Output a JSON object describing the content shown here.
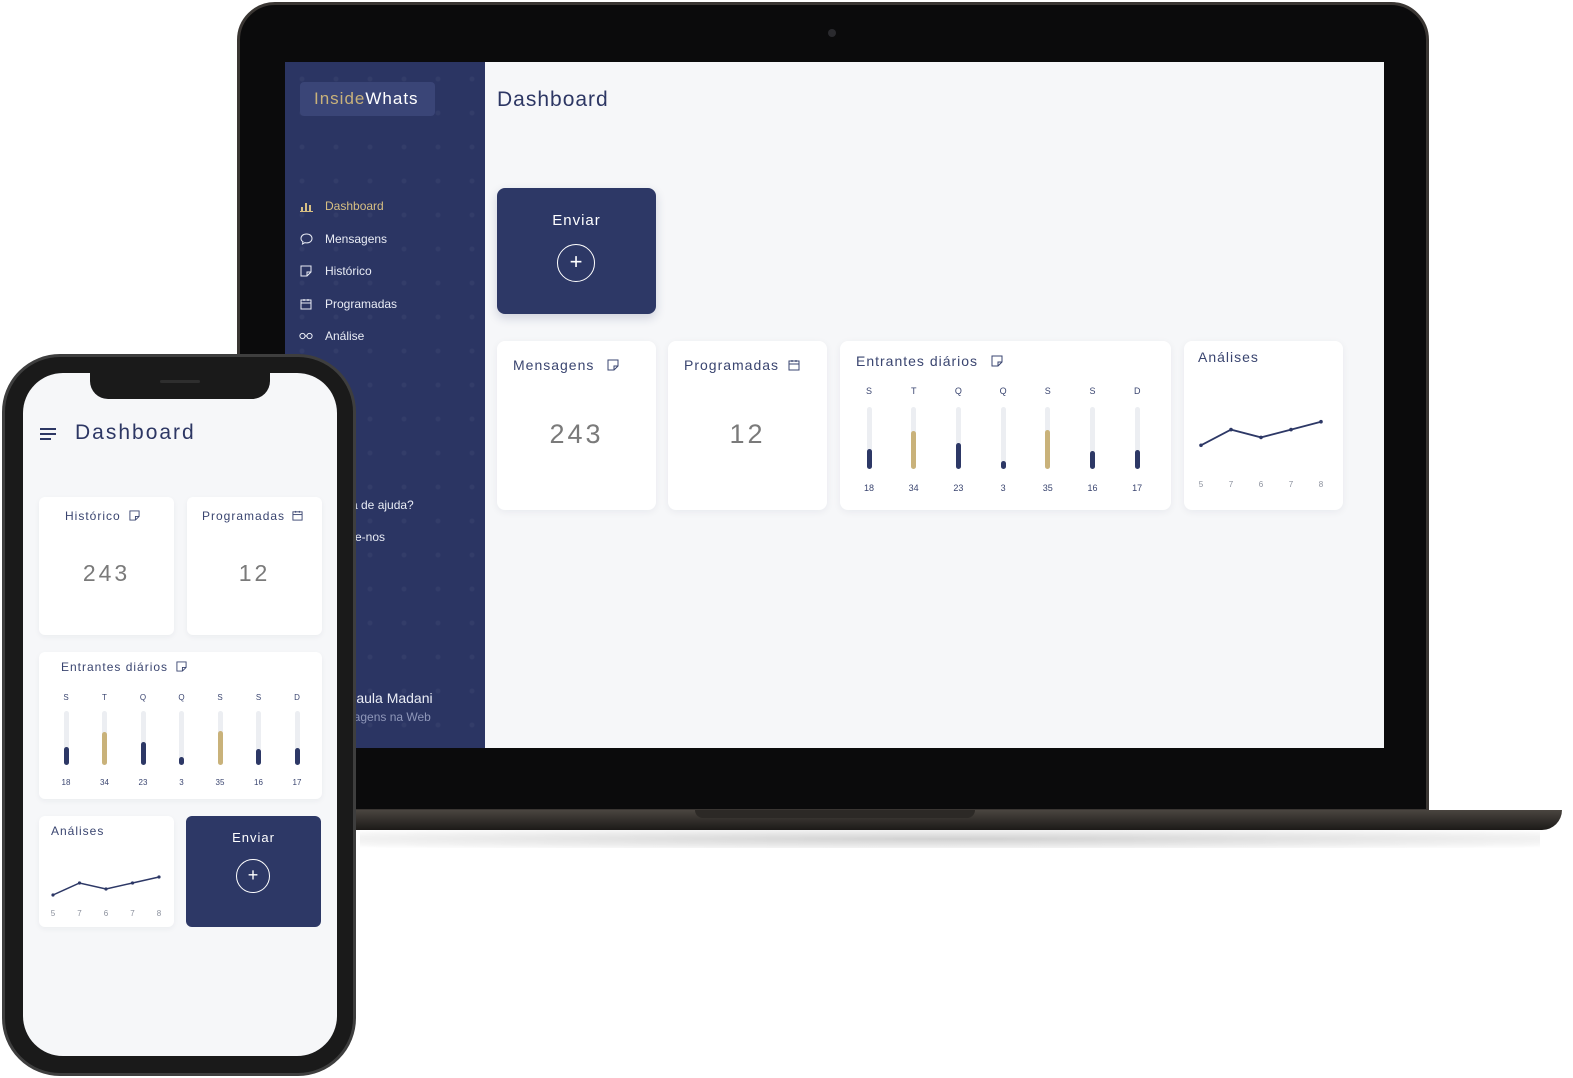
{
  "laptop": {
    "logo": {
      "part1": "Inside",
      "part2": "Whats"
    },
    "nav": [
      {
        "label": "Dashboard",
        "icon": "bar-chart-icon",
        "active": true
      },
      {
        "label": "Mensagens",
        "icon": "message-icon",
        "active": false
      },
      {
        "label": "Histórico",
        "icon": "note-icon",
        "active": false
      },
      {
        "label": "Programadas",
        "icon": "calendar-icon",
        "active": false
      },
      {
        "label": "Análise",
        "icon": "glasses-icon",
        "active": false
      }
    ],
    "help_text": "sa de ajuda?",
    "contact_text": "ate-nos",
    "user": {
      "name": "Paula Madani",
      "subtitle": "nagens na Web"
    },
    "page_title": "Dashboard",
    "send_card": {
      "label": "Enviar",
      "icon": "plus-icon"
    },
    "cards": {
      "mensagens": {
        "title": "Mensagens",
        "value": "243",
        "icon": "note-icon"
      },
      "programadas": {
        "title": "Programadas",
        "value": "12",
        "icon": "calendar-icon"
      },
      "entrantes": {
        "title": "Entrantes diários",
        "icon": "note-icon"
      },
      "analises": {
        "title": "Análises"
      }
    }
  },
  "phone": {
    "page_title": "Dashboard",
    "cards": {
      "historico": {
        "title": "Histórico",
        "value": "243",
        "icon": "note-icon"
      },
      "programadas": {
        "title": "Programadas",
        "value": "12",
        "icon": "calendar-icon"
      },
      "entrantes": {
        "title": "Entrantes diários",
        "icon": "note-icon"
      },
      "analises": {
        "title": "Análises"
      }
    },
    "send_card": {
      "label": "Enviar",
      "icon": "plus-icon"
    }
  },
  "colors": {
    "navy": "#2d3866",
    "gold": "#c9b27a",
    "background": "#f6f7f9"
  },
  "chart_data": [
    {
      "type": "bar",
      "title": "Entrantes diários",
      "categories": [
        "S",
        "T",
        "Q",
        "Q",
        "S",
        "S",
        "D"
      ],
      "values": [
        18,
        34,
        23,
        3,
        35,
        16,
        17
      ],
      "highlight": [
        false,
        true,
        false,
        false,
        true,
        false,
        false
      ],
      "ylim": [
        0,
        55
      ]
    },
    {
      "type": "line",
      "title": "Análises",
      "x": [
        "5",
        "7",
        "6",
        "7",
        "8"
      ],
      "y": [
        5,
        7,
        6,
        7,
        8
      ],
      "ylim": [
        3,
        10
      ]
    }
  ]
}
